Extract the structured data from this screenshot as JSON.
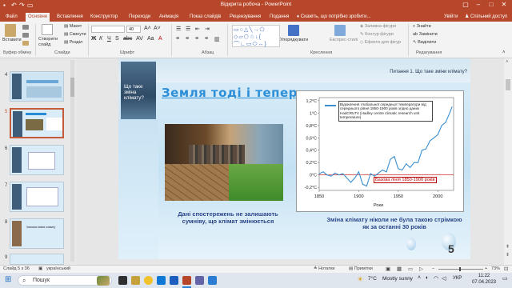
{
  "app": {
    "title": "Відкрита робоча - PowerPoint",
    "accent": "#b7472a"
  },
  "tabs": [
    {
      "label": "Файл"
    },
    {
      "label": "Основне"
    },
    {
      "label": "Вставлення"
    },
    {
      "label": "Конструктор"
    },
    {
      "label": "Переходи"
    },
    {
      "label": "Анімація"
    },
    {
      "label": "Показ слайдів"
    },
    {
      "label": "Рецензування"
    },
    {
      "label": "Подання"
    }
  ],
  "tellme": "Скажіть, що потрібно зробити...",
  "user": "Увійти",
  "share": "Спільний доступ",
  "ribbon": {
    "paste": "Вставити",
    "create_slide": "Створити слайд",
    "layout": "Макет",
    "reset": "Скинути",
    "section": "Розділ",
    "font_size": "40",
    "arrange": "Упорядкувати",
    "quick_styles": "Експрес-стилі",
    "shape_fill": "Заливка фігури",
    "shape_outline": "Контур фігури",
    "shape_effects": "Ефекти для фігур",
    "find": "Знайти",
    "replace": "Замінити",
    "select": "Виділити",
    "groups": {
      "clipboard": "Буфер обміну",
      "slides": "Слайди",
      "font": "Шрифт",
      "paragraph": "Абзац",
      "drawing": "Креслення",
      "editing": "Редагування"
    }
  },
  "thumbnails": [
    {
      "num": "4"
    },
    {
      "num": "5"
    },
    {
      "num": "6"
    },
    {
      "num": "7"
    },
    {
      "num": "8"
    },
    {
      "num": "9"
    }
  ],
  "thumb_text": {
    "t8": "Чинники зміни клімату"
  },
  "slide": {
    "sidebar_text": "Що таке зміна клімату?",
    "question": "Питання 1. Що таке зміни клімату?",
    "title": "Земля тоді і тепер",
    "caption1": "Дані спостережень не залишають сумніву, що клімат змінюється",
    "caption2": "Зміна клімату ніколи   не була такою стрімкою як за останні 30 років",
    "page_number": "5"
  },
  "chart_data": {
    "type": "line",
    "title": "",
    "legend": "Відхилення глобальної середньої температури від середнього рівня 1850-1900 років згідно даних HadCRUT4 (Hadley centre climatic research unit temperature)",
    "baseline_label": "Базова лінія 1850-1900 років",
    "xlabel": "Роки",
    "ylabel": "",
    "xlim": [
      1850,
      2020
    ],
    "ylim": [
      -0.25,
      1.25
    ],
    "x_ticks": [
      "1850",
      "1900",
      "1950",
      "2000"
    ],
    "y_ticks": [
      "1,2°C",
      "1°C",
      "0,8°C",
      "0,6°C",
      "0,4°C",
      "0,2°C",
      "0°C",
      "-0,2°C"
    ],
    "line_color": "#3a8fd0",
    "series": [
      {
        "x": [
          1850,
          1855,
          1860,
          1865,
          1870,
          1875,
          1880,
          1885,
          1890,
          1895,
          1900,
          1905,
          1910,
          1915,
          1920,
          1925,
          1930,
          1935,
          1940,
          1945,
          1950,
          1955,
          1960,
          1965,
          1970,
          1975,
          1980,
          1985,
          1990,
          1995,
          2000,
          2005,
          2010,
          2015,
          2018
        ],
        "values": [
          0.02,
          0.05,
          0.0,
          -0.02,
          0.03,
          0.0,
          0.02,
          -0.05,
          -0.12,
          -0.05,
          0.05,
          -0.15,
          -0.18,
          0.02,
          -0.02,
          0.03,
          0.08,
          0.05,
          0.25,
          0.3,
          0.1,
          0.08,
          0.18,
          0.12,
          0.2,
          0.2,
          0.4,
          0.42,
          0.55,
          0.6,
          0.65,
          0.8,
          0.85,
          1.0,
          1.1
        ]
      }
    ]
  },
  "status": {
    "slide_of": "Слайд 5 з 36",
    "language": "український",
    "notes": "Нотатки",
    "comments": "Примітки",
    "zoom": "73%"
  },
  "taskbar": {
    "search": "Пошук",
    "weather_temp": "7°C",
    "weather_text": "Mostly sunny",
    "lang": "УКР",
    "time": "11:22",
    "date": "07.04.2023"
  }
}
